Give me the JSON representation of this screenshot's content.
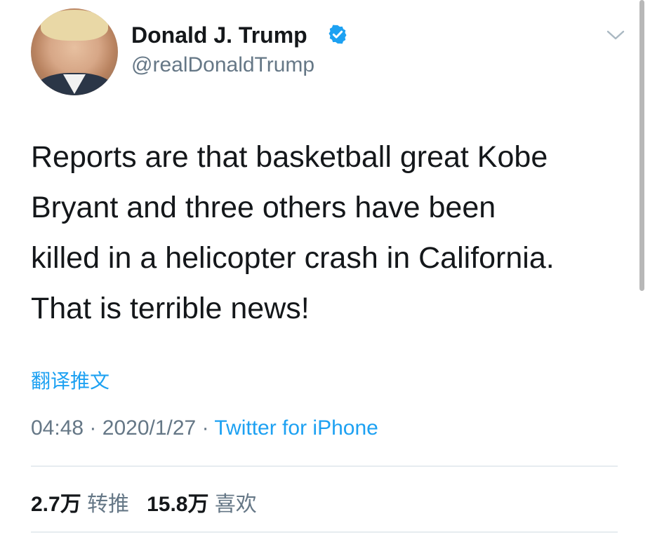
{
  "profile": {
    "name": "Donald J. Trump",
    "handle": "@realDonaldTrump",
    "verified_color": "#1da1f2"
  },
  "tweet": {
    "lines": [
      "Reports are that basketball great Kobe",
      "Bryant and three others have been",
      "killed in a helicopter crash in California.",
      "That is terrible news!"
    ],
    "translate_label": "翻译推文",
    "time": "04:48",
    "date": "2020/1/27",
    "separator": "·",
    "source": "Twitter for iPhone"
  },
  "stats": {
    "retweets_count": "2.7万",
    "retweets_label": "转推",
    "likes_count": "15.8万",
    "likes_label": "喜欢"
  },
  "colors": {
    "accent": "#1da1f2",
    "secondary_text": "#657786",
    "primary_text": "#14171a"
  },
  "icons": {
    "verified": "verified-badge-icon",
    "menu": "chevron-down-icon"
  }
}
